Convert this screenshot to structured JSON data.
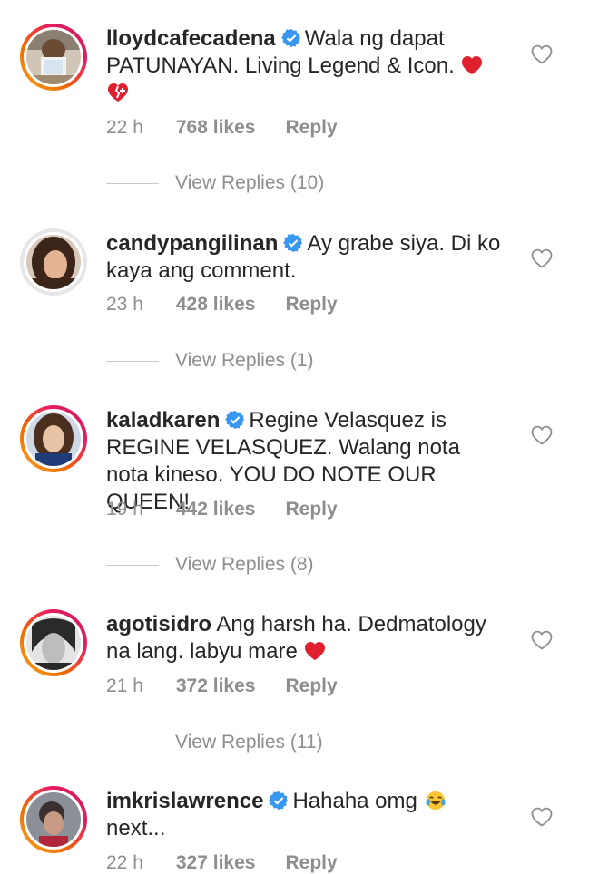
{
  "comments": [
    {
      "username": "lloydcafecadena",
      "verified": true,
      "text": "Wala ng dapat PATUNAYAN. Living Legend & Icon.",
      "emoji": [
        "red-heart",
        "broken-heart"
      ],
      "time": "22 h",
      "likes": "768 likes",
      "reply_label": "Reply",
      "view_replies": "View Replies (10)",
      "has_story_ring": true
    },
    {
      "username": "candypangilinan",
      "verified": true,
      "text": "Ay grabe siya. Di ko kaya ang comment.",
      "time": "23 h",
      "likes": "428 likes",
      "reply_label": "Reply",
      "view_replies": "View Replies (1)",
      "has_story_ring": false
    },
    {
      "username": "kaladkaren",
      "verified": true,
      "text": "Regine Velasquez is REGINE VELASQUEZ. Walang nota nota kineso. YOU DO NOTE OUR QUEEN!",
      "time": "19 h",
      "likes": "442 likes",
      "reply_label": "Reply",
      "view_replies": "View Replies (8)",
      "has_story_ring": true
    },
    {
      "username": "agotisidro",
      "verified": false,
      "text": "Ang harsh ha. Dedmatology na lang. labyu mare",
      "emoji": [
        "red-heart"
      ],
      "time": "21 h",
      "likes": "372 likes",
      "reply_label": "Reply",
      "view_replies": "View Replies (11)",
      "has_story_ring": true
    },
    {
      "username": "imkrislawrence",
      "verified": true,
      "text": "Hahaha omg",
      "text_after_emoji": "next...",
      "emoji": [
        "tears-of-joy"
      ],
      "time": "22 h",
      "likes": "327 likes",
      "reply_label": "Reply",
      "has_story_ring": true
    }
  ],
  "colors": {
    "primary_text": "#262626",
    "secondary_text": "#8e8e8e",
    "verified_blue": "#3897f0",
    "heart_red": "#ed4956"
  }
}
